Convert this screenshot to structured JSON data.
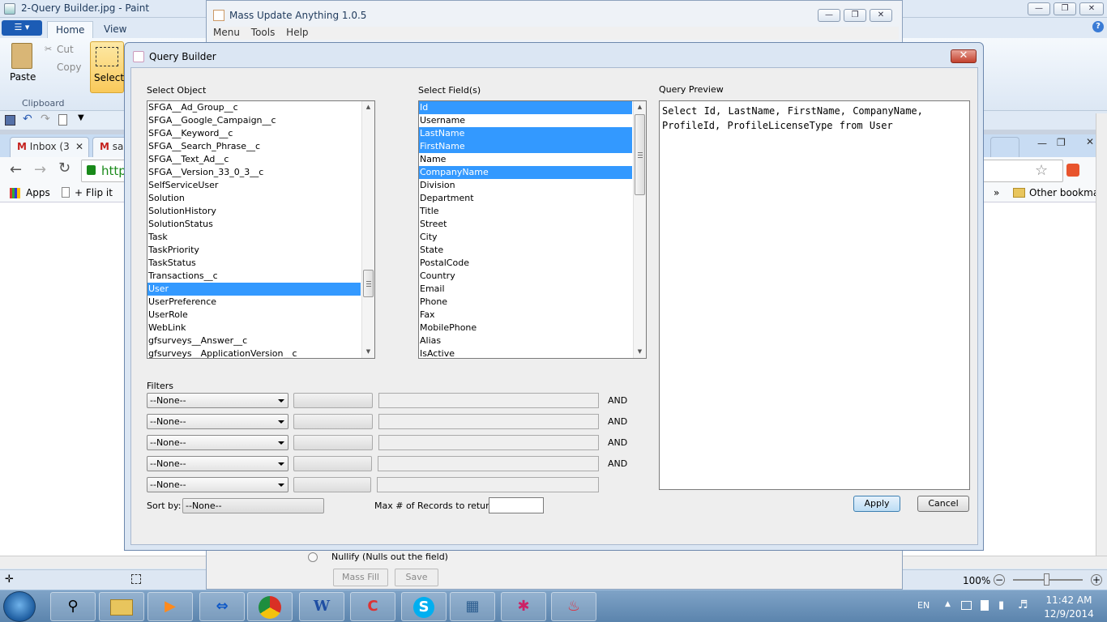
{
  "paint": {
    "title": "2-Query Builder.jpg - Paint",
    "tabs": [
      "Home",
      "View"
    ],
    "clipboard": {
      "paste": "Paste",
      "cut": "Cut",
      "copy": "Copy",
      "group": "Clipboard",
      "select": "Select"
    },
    "zoom": "100%"
  },
  "chrome": {
    "tabs": [
      "Inbox (3",
      "sa"
    ],
    "address": "http",
    "bookmarks": [
      "Apps",
      "+ Flip it"
    ],
    "other_bookmarks": "Other bookma"
  },
  "mass_update": {
    "title": "Mass Update Anything 1.0.5",
    "menu": [
      "Menu",
      "Tools",
      "Help"
    ],
    "nullify_label": "Nullify (Nulls out the field)",
    "mass_fill": "Mass Fill",
    "save": "Save"
  },
  "dialog": {
    "title": "Query Builder",
    "select_object_label": "Select Object",
    "select_fields_label": "Select Field(s)",
    "query_preview_label": "Query Preview",
    "objects": [
      {
        "name": "SFGA__Ad_Group__c",
        "selected": false
      },
      {
        "name": "SFGA__Google_Campaign__c",
        "selected": false
      },
      {
        "name": "SFGA__Keyword__c",
        "selected": false
      },
      {
        "name": "SFGA__Search_Phrase__c",
        "selected": false
      },
      {
        "name": "SFGA__Text_Ad__c",
        "selected": false
      },
      {
        "name": "SFGA__Version_33_0_3__c",
        "selected": false
      },
      {
        "name": "SelfServiceUser",
        "selected": false
      },
      {
        "name": "Solution",
        "selected": false
      },
      {
        "name": "SolutionHistory",
        "selected": false
      },
      {
        "name": "SolutionStatus",
        "selected": false
      },
      {
        "name": "Task",
        "selected": false
      },
      {
        "name": "TaskPriority",
        "selected": false
      },
      {
        "name": "TaskStatus",
        "selected": false
      },
      {
        "name": "Transactions__c",
        "selected": false
      },
      {
        "name": "User",
        "selected": true
      },
      {
        "name": "UserPreference",
        "selected": false
      },
      {
        "name": "UserRole",
        "selected": false
      },
      {
        "name": "WebLink",
        "selected": false
      },
      {
        "name": "gfsurveys__Answer__c",
        "selected": false
      },
      {
        "name": "gfsurveys__ApplicationVersion__c",
        "selected": false
      }
    ],
    "fields": [
      {
        "name": "Id",
        "selected": true
      },
      {
        "name": "Username",
        "selected": false
      },
      {
        "name": "LastName",
        "selected": true
      },
      {
        "name": "FirstName",
        "selected": true
      },
      {
        "name": "Name",
        "selected": false
      },
      {
        "name": "CompanyName",
        "selected": true
      },
      {
        "name": "Division",
        "selected": false
      },
      {
        "name": "Department",
        "selected": false
      },
      {
        "name": "Title",
        "selected": false
      },
      {
        "name": "Street",
        "selected": false
      },
      {
        "name": "City",
        "selected": false
      },
      {
        "name": "State",
        "selected": false
      },
      {
        "name": "PostalCode",
        "selected": false
      },
      {
        "name": "Country",
        "selected": false
      },
      {
        "name": "Email",
        "selected": false
      },
      {
        "name": "Phone",
        "selected": false
      },
      {
        "name": "Fax",
        "selected": false
      },
      {
        "name": "MobilePhone",
        "selected": false
      },
      {
        "name": "Alias",
        "selected": false
      },
      {
        "name": "IsActive",
        "selected": false
      }
    ],
    "query_preview": "Select Id, LastName, FirstName, CompanyName,\nProfileId, ProfileLicenseType from User",
    "filters_label": "Filters",
    "filters": [
      {
        "field": "--None--",
        "conjunction": "AND"
      },
      {
        "field": "--None--",
        "conjunction": "AND"
      },
      {
        "field": "--None--",
        "conjunction": "AND"
      },
      {
        "field": "--None--",
        "conjunction": "AND"
      },
      {
        "field": "--None--",
        "conjunction": ""
      }
    ],
    "sort_by_label": "Sort by:",
    "sort_by_value": "--None--",
    "max_records_label": "Max # of Records to return:",
    "max_records_value": "",
    "apply": "Apply",
    "cancel": "Cancel"
  },
  "taskbar": {
    "apps": [
      "Search",
      "Explorer",
      "Media",
      "TeamViewer",
      "Chrome",
      "Word",
      "CCleaner",
      "Skype",
      "Control Panel",
      "Paint",
      "Java"
    ],
    "language": "EN",
    "time": "11:42 AM",
    "date": "12/9/2014"
  }
}
